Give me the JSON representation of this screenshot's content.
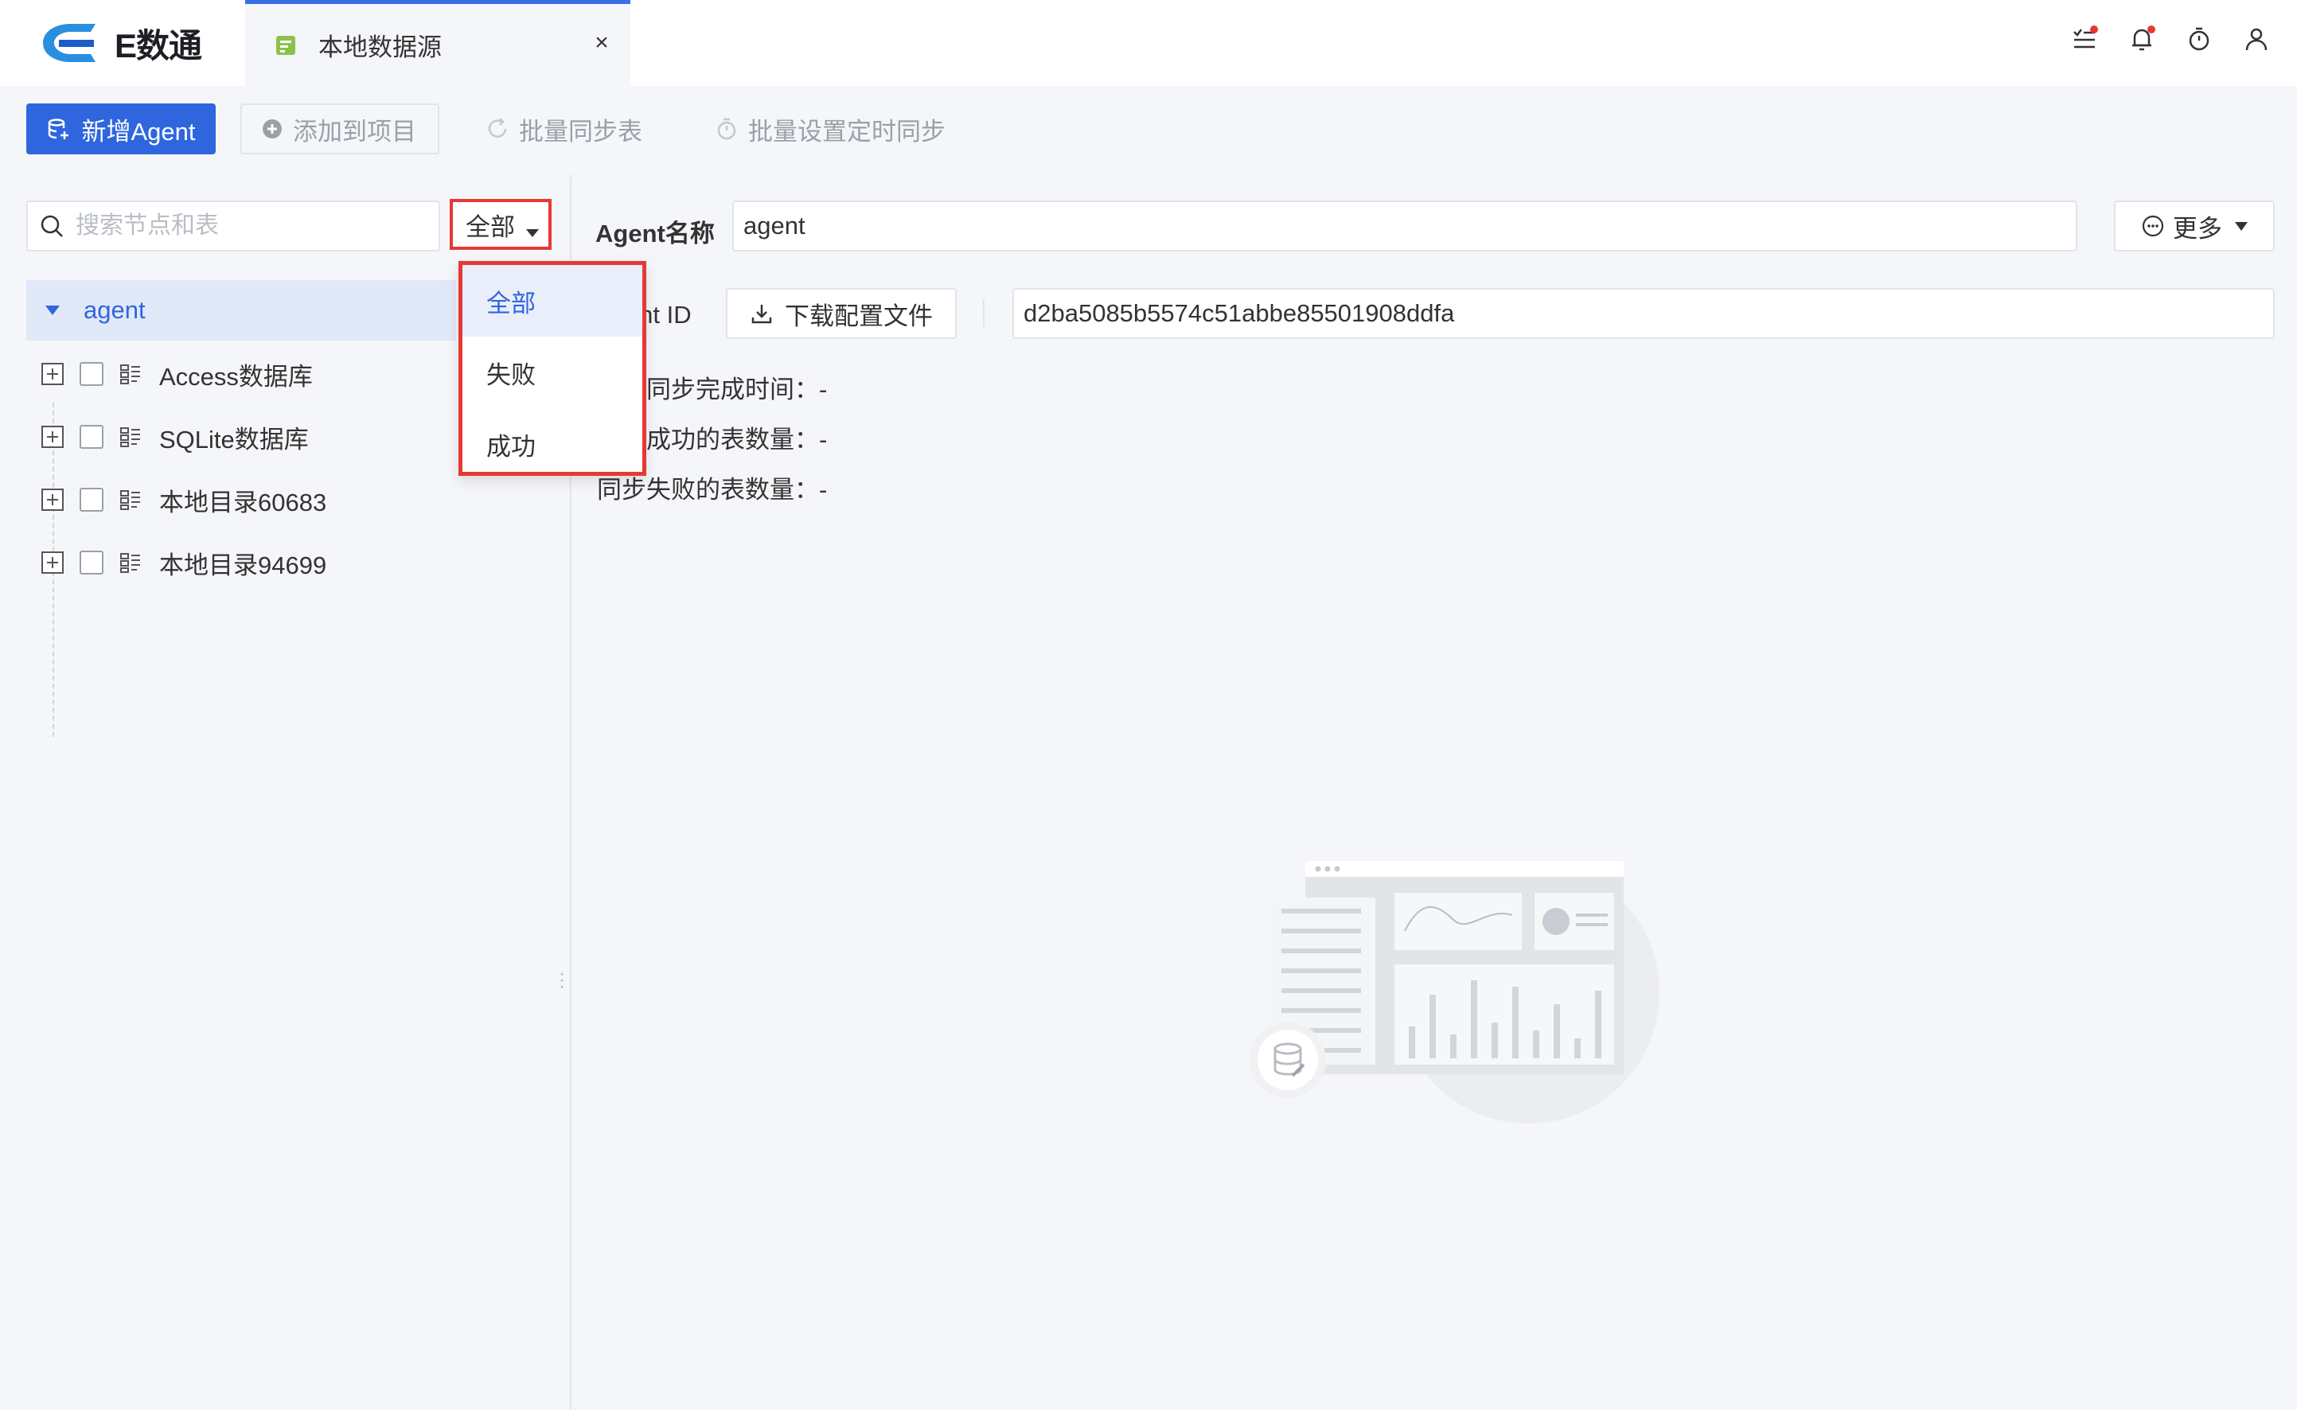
{
  "app": {
    "logo_text": "E数通",
    "tab_label": "本地数据源",
    "tab_close": "×"
  },
  "toolbar": {
    "new_agent": "新增Agent",
    "add_to_project": "添加到项目",
    "batch_sync": "批量同步表",
    "batch_schedule": "批量设置定时同步"
  },
  "left": {
    "search_placeholder": "搜索节点和表",
    "filter_value": "全部",
    "root_label": "agent",
    "items": [
      {
        "label": "Access数据库"
      },
      {
        "label": "SQLite数据库"
      },
      {
        "label": "本地目录60683"
      },
      {
        "label": "本地目录94699"
      }
    ]
  },
  "dropdown": {
    "options": [
      "全部",
      "失败",
      "成功"
    ],
    "selected": "全部"
  },
  "right": {
    "agent_name_label": "Agent名称",
    "agent_name_value": "agent",
    "more_label": "更多",
    "agent_id_label": "Agent ID",
    "download_label": "下载配置文件",
    "agent_id_value": "d2ba5085b5574c51abbe85501908ddfa",
    "stats": [
      {
        "label": "上次同步完成时间：",
        "value": "-"
      },
      {
        "label": "同步成功的表数量：",
        "value": "-"
      },
      {
        "label": "同步失败的表数量：",
        "value": "-"
      }
    ]
  },
  "colors": {
    "primary": "#2f66de",
    "highlight_red": "#e53935",
    "background": "#f5f6f9"
  }
}
